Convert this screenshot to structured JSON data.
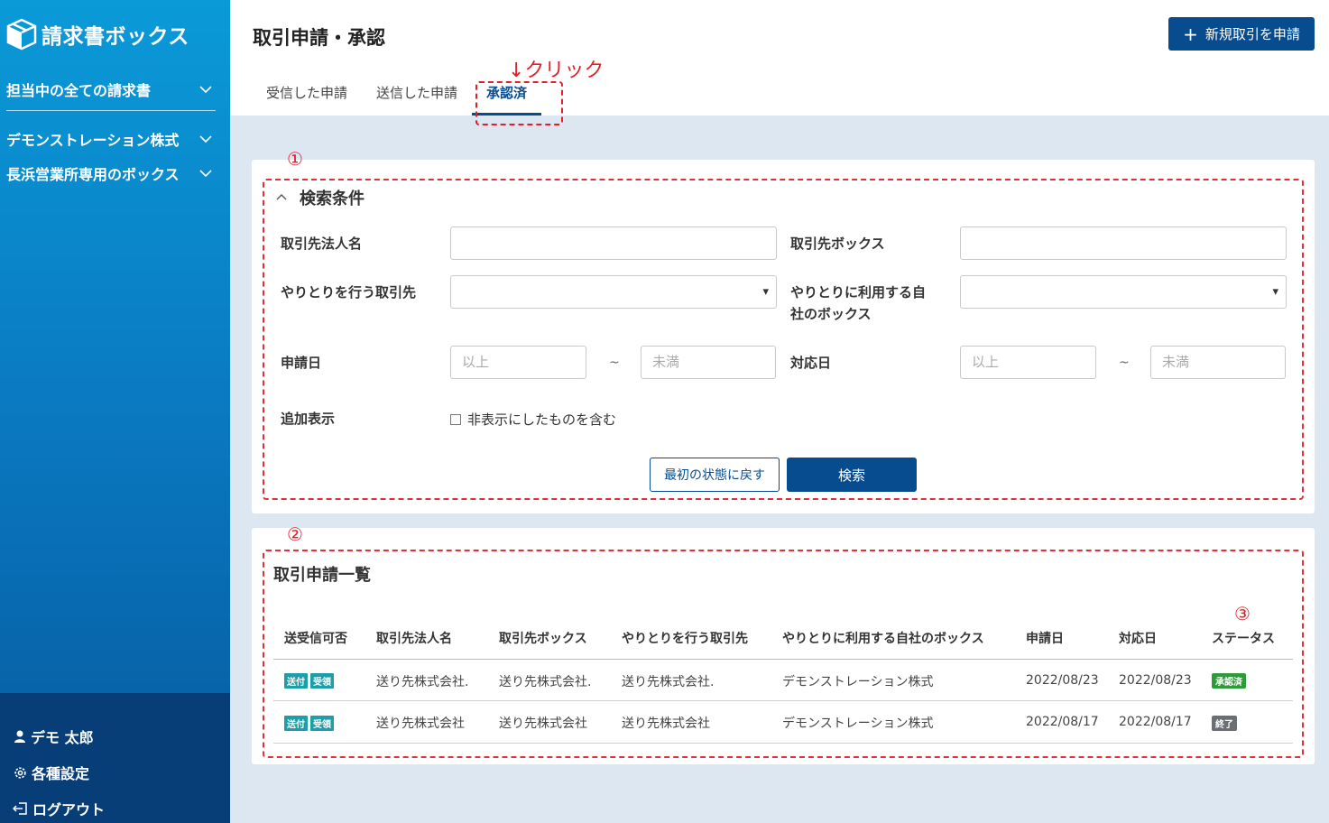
{
  "brand": {
    "name": "請求書ボックス"
  },
  "sidebar": {
    "items": [
      {
        "label": "担当中の全ての請求書"
      },
      {
        "label": "デモンストレーション株式"
      },
      {
        "label": "長浜営業所専用のボックス"
      }
    ],
    "bottom": {
      "user": "デモ 太郎",
      "settings": "各種設定",
      "logout": "ログアウト"
    }
  },
  "header": {
    "title": "取引申請・承認",
    "new_button": "新規取引を申請",
    "tabs": [
      {
        "label": "受信した申請"
      },
      {
        "label": "送信した申請"
      },
      {
        "label": "承認済"
      }
    ]
  },
  "annotations": {
    "click": "↓クリック",
    "n1": "①",
    "n2": "②",
    "n3": "③"
  },
  "search": {
    "title": "検索条件",
    "partner_name_label": "取引先法人名",
    "partner_box_label": "取引先ボックス",
    "trading_partner_label": "やりとりを行う取引先",
    "own_box_label_1": "やりとりに利用する自",
    "own_box_label_2": "社のボックス",
    "apply_date_label": "申請日",
    "response_date_label": "対応日",
    "from_placeholder": "以上",
    "to_placeholder": "未満",
    "tilde": "~",
    "extra_label": "追加表示",
    "include_hidden": "非表示にしたものを含む",
    "reset_button": "最初の状態に戻す",
    "search_button": "検索"
  },
  "list": {
    "title": "取引申請一覧",
    "columns": [
      "送受信可否",
      "取引先法人名",
      "取引先ボックス",
      "やりとりを行う取引先",
      "やりとりに利用する自社のボックス",
      "申請日",
      "対応日",
      "ステータス"
    ],
    "tags": {
      "send": "送付",
      "receive": "受領"
    },
    "rows": [
      {
        "partner_name": "送り先株式会社.",
        "partner_box": "送り先株式会社.",
        "trading_partner": "送り先株式会社.",
        "own_box": "デモンストレーション株式",
        "apply_date": "2022/08/23",
        "response_date": "2022/08/23",
        "status": "承認済",
        "status_color": "#2e9a38"
      },
      {
        "partner_name": "送り先株式会社",
        "partner_box": "送り先株式会社",
        "trading_partner": "送り先株式会社",
        "own_box": "デモンストレーション株式",
        "apply_date": "2022/08/17",
        "response_date": "2022/08/17",
        "status": "終了",
        "status_color": "#6b6f73"
      }
    ]
  },
  "colors": {
    "primary": "#074c8e",
    "annotation": "#e0202a",
    "tag": "#1d9ea8"
  }
}
